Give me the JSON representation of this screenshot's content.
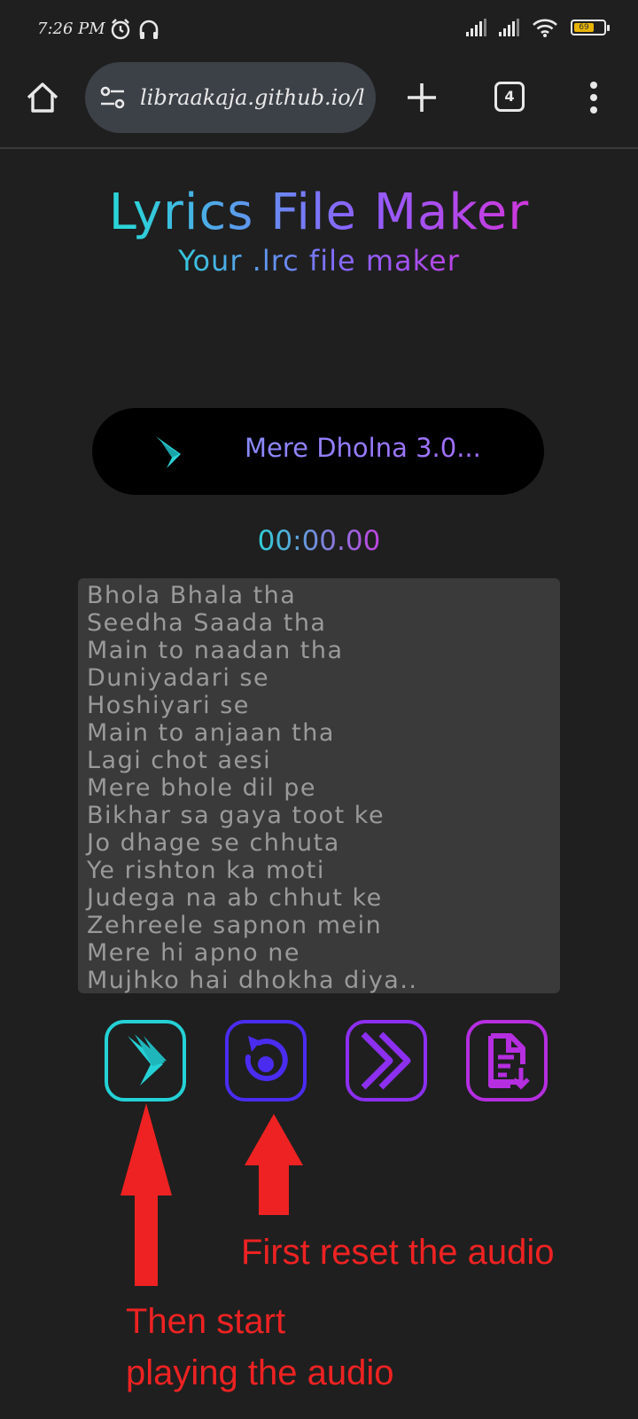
{
  "status_bar": {
    "time": "7:26 PM",
    "battery_level": "69",
    "battery_color": "#e8b400"
  },
  "browser": {
    "url": "libraakaja.github.io/l",
    "tab_count": "4",
    "icons": [
      "home-icon",
      "site-settings-icon",
      "plus-icon",
      "tabs-icon",
      "more-vert-icon"
    ]
  },
  "app": {
    "title": "Lyrics File Maker",
    "subtitle": "Your .lrc file maker",
    "accent_colors": [
      "#2ad4d8",
      "#8a63ff",
      "#d333d9"
    ]
  },
  "player": {
    "song_title": "Mere Dholna 3.0...",
    "timer": "00:00.00"
  },
  "lyrics": [
    "Bhola Bhala tha",
    "Seedha Saada tha",
    "Main to naadan tha",
    "Duniyadari se",
    "Hoshiyari se",
    "Main to anjaan tha",
    "Lagi chot aesi",
    "Mere bhole dil pe",
    "Bikhar sa gaya toot ke",
    "Jo dhage se chhuta",
    "Ye rishton ka moti",
    "Judega na ab chhut ke",
    "Zehreele sapnon mein",
    "Mere hi apno ne",
    "Mujhko hai dhokha diya.."
  ],
  "controls": [
    {
      "name": "play-button",
      "icon": "play-wing-icon",
      "color": "#24d1d6"
    },
    {
      "name": "reset-button",
      "icon": "reset-icon",
      "color": "#4a2cf0"
    },
    {
      "name": "next-line-button",
      "icon": "double-chevron-right-icon",
      "color": "#8c2ff0"
    },
    {
      "name": "download-file-button",
      "icon": "file-download-icon",
      "color": "#b52ee0"
    }
  ],
  "annotations": {
    "reset_note": "First reset the audio",
    "play_note_line1": "Then start",
    "play_note_line2": "playing the audio",
    "arrow_color": "#ee2222"
  }
}
